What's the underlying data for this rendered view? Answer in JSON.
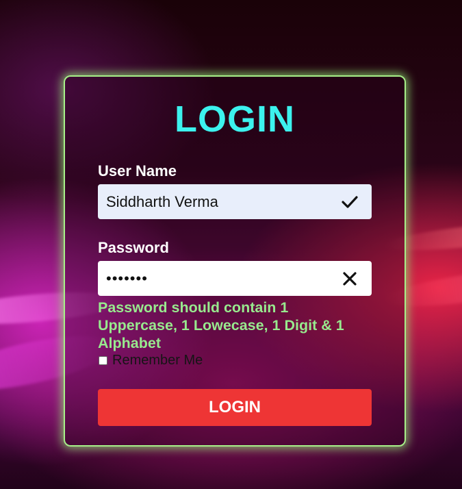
{
  "form": {
    "title": "LOGIN",
    "username_label": "User Name",
    "username_value": "Siddharth Verma",
    "username_status_icon": "check-icon",
    "password_label": "Password",
    "password_value": "•••••••",
    "password_status_icon": "close-icon",
    "error_message": "Password should contain 1 Uppercase, 1 Lowecase, 1 Digit & 1 Alphabet",
    "remember_label": "Remember Me",
    "remember_checked": false,
    "submit_label": "LOGIN"
  },
  "colors": {
    "title": "#3cf2ee",
    "card_border": "#a7f089",
    "error_text": "#98ea8e",
    "button": "#ee3535",
    "username_field_bg": "#e8eefb"
  }
}
